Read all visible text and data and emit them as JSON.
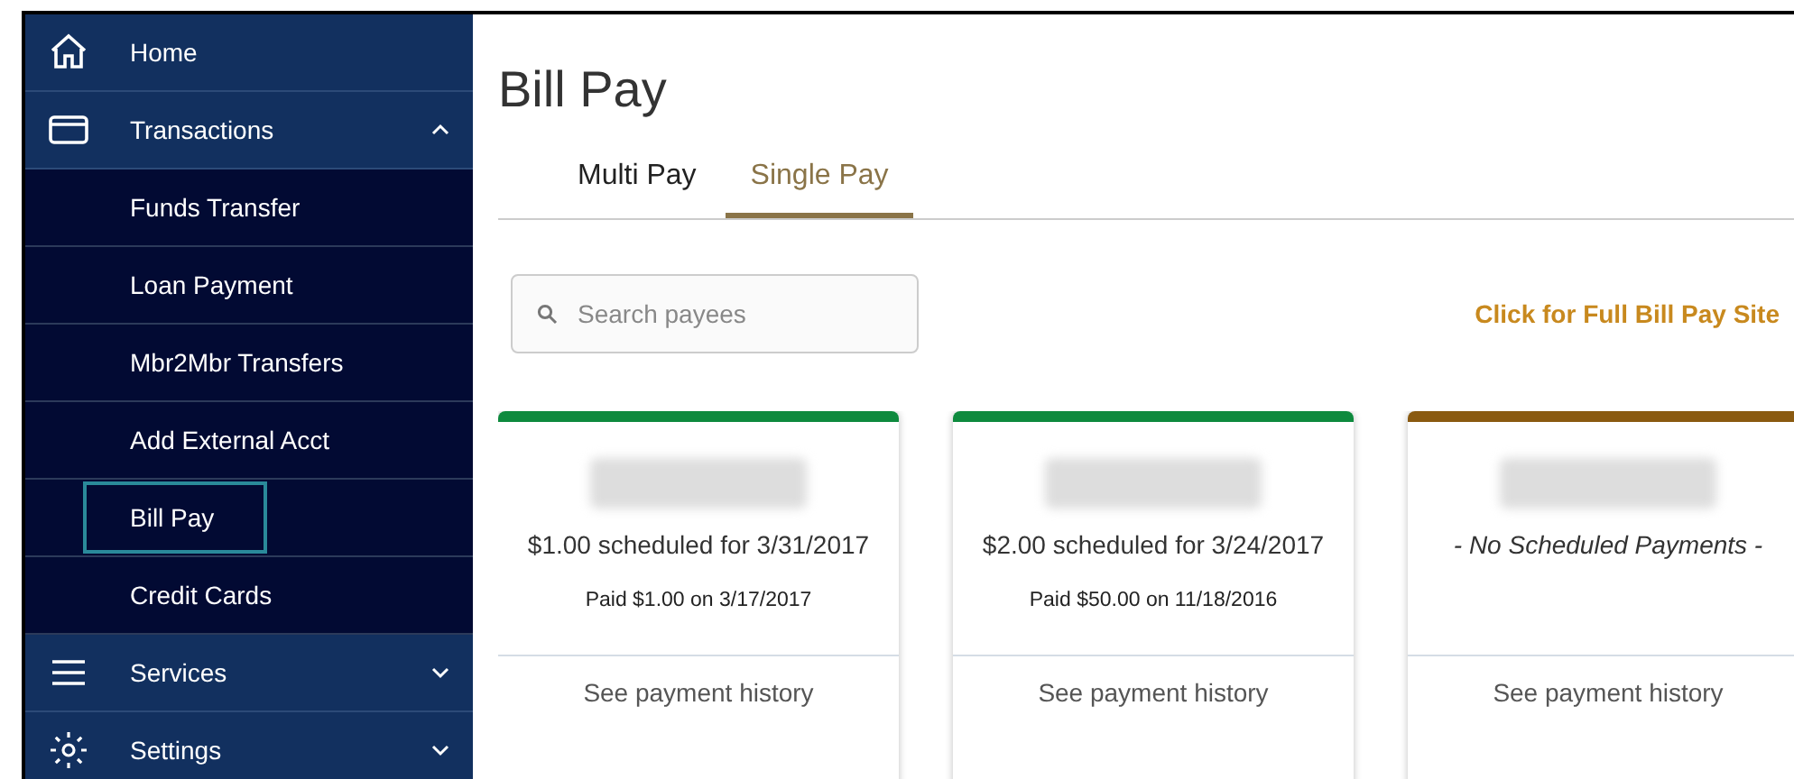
{
  "sidebar": {
    "items": [
      {
        "label": "Home"
      },
      {
        "label": "Transactions",
        "expanded": true,
        "children": [
          {
            "label": "Funds Transfer",
            "selected": false
          },
          {
            "label": "Loan Payment",
            "selected": false
          },
          {
            "label": "Mbr2Mbr Transfers",
            "selected": false
          },
          {
            "label": "Add External Acct",
            "selected": false
          },
          {
            "label": "Bill Pay",
            "selected": true
          },
          {
            "label": "Credit Cards",
            "selected": false
          }
        ]
      },
      {
        "label": "Services",
        "expanded": false
      },
      {
        "label": "Settings",
        "expanded": false
      }
    ]
  },
  "page": {
    "title": "Bill Pay",
    "tabs": [
      {
        "label": "Multi Pay",
        "selected": false
      },
      {
        "label": "Single Pay",
        "selected": true
      }
    ],
    "search": {
      "placeholder": "Search payees"
    },
    "full_site_link": "Click for Full Bill Pay Site",
    "payees": [
      {
        "color": "#0e8a3e",
        "kind": "scheduled",
        "scheduled": "$1.00 scheduled for 3/31/2017",
        "paid": "Paid $1.00 on 3/17/2017",
        "history": "See payment history"
      },
      {
        "color": "#0e8a3e",
        "kind": "scheduled",
        "scheduled": "$2.00 scheduled for 3/24/2017",
        "paid": "Paid $50.00 on 11/18/2016",
        "history": "See payment history"
      },
      {
        "color": "#8a5a10",
        "kind": "none",
        "scheduled": "- No Scheduled Payments -",
        "history": "See payment history"
      }
    ]
  }
}
